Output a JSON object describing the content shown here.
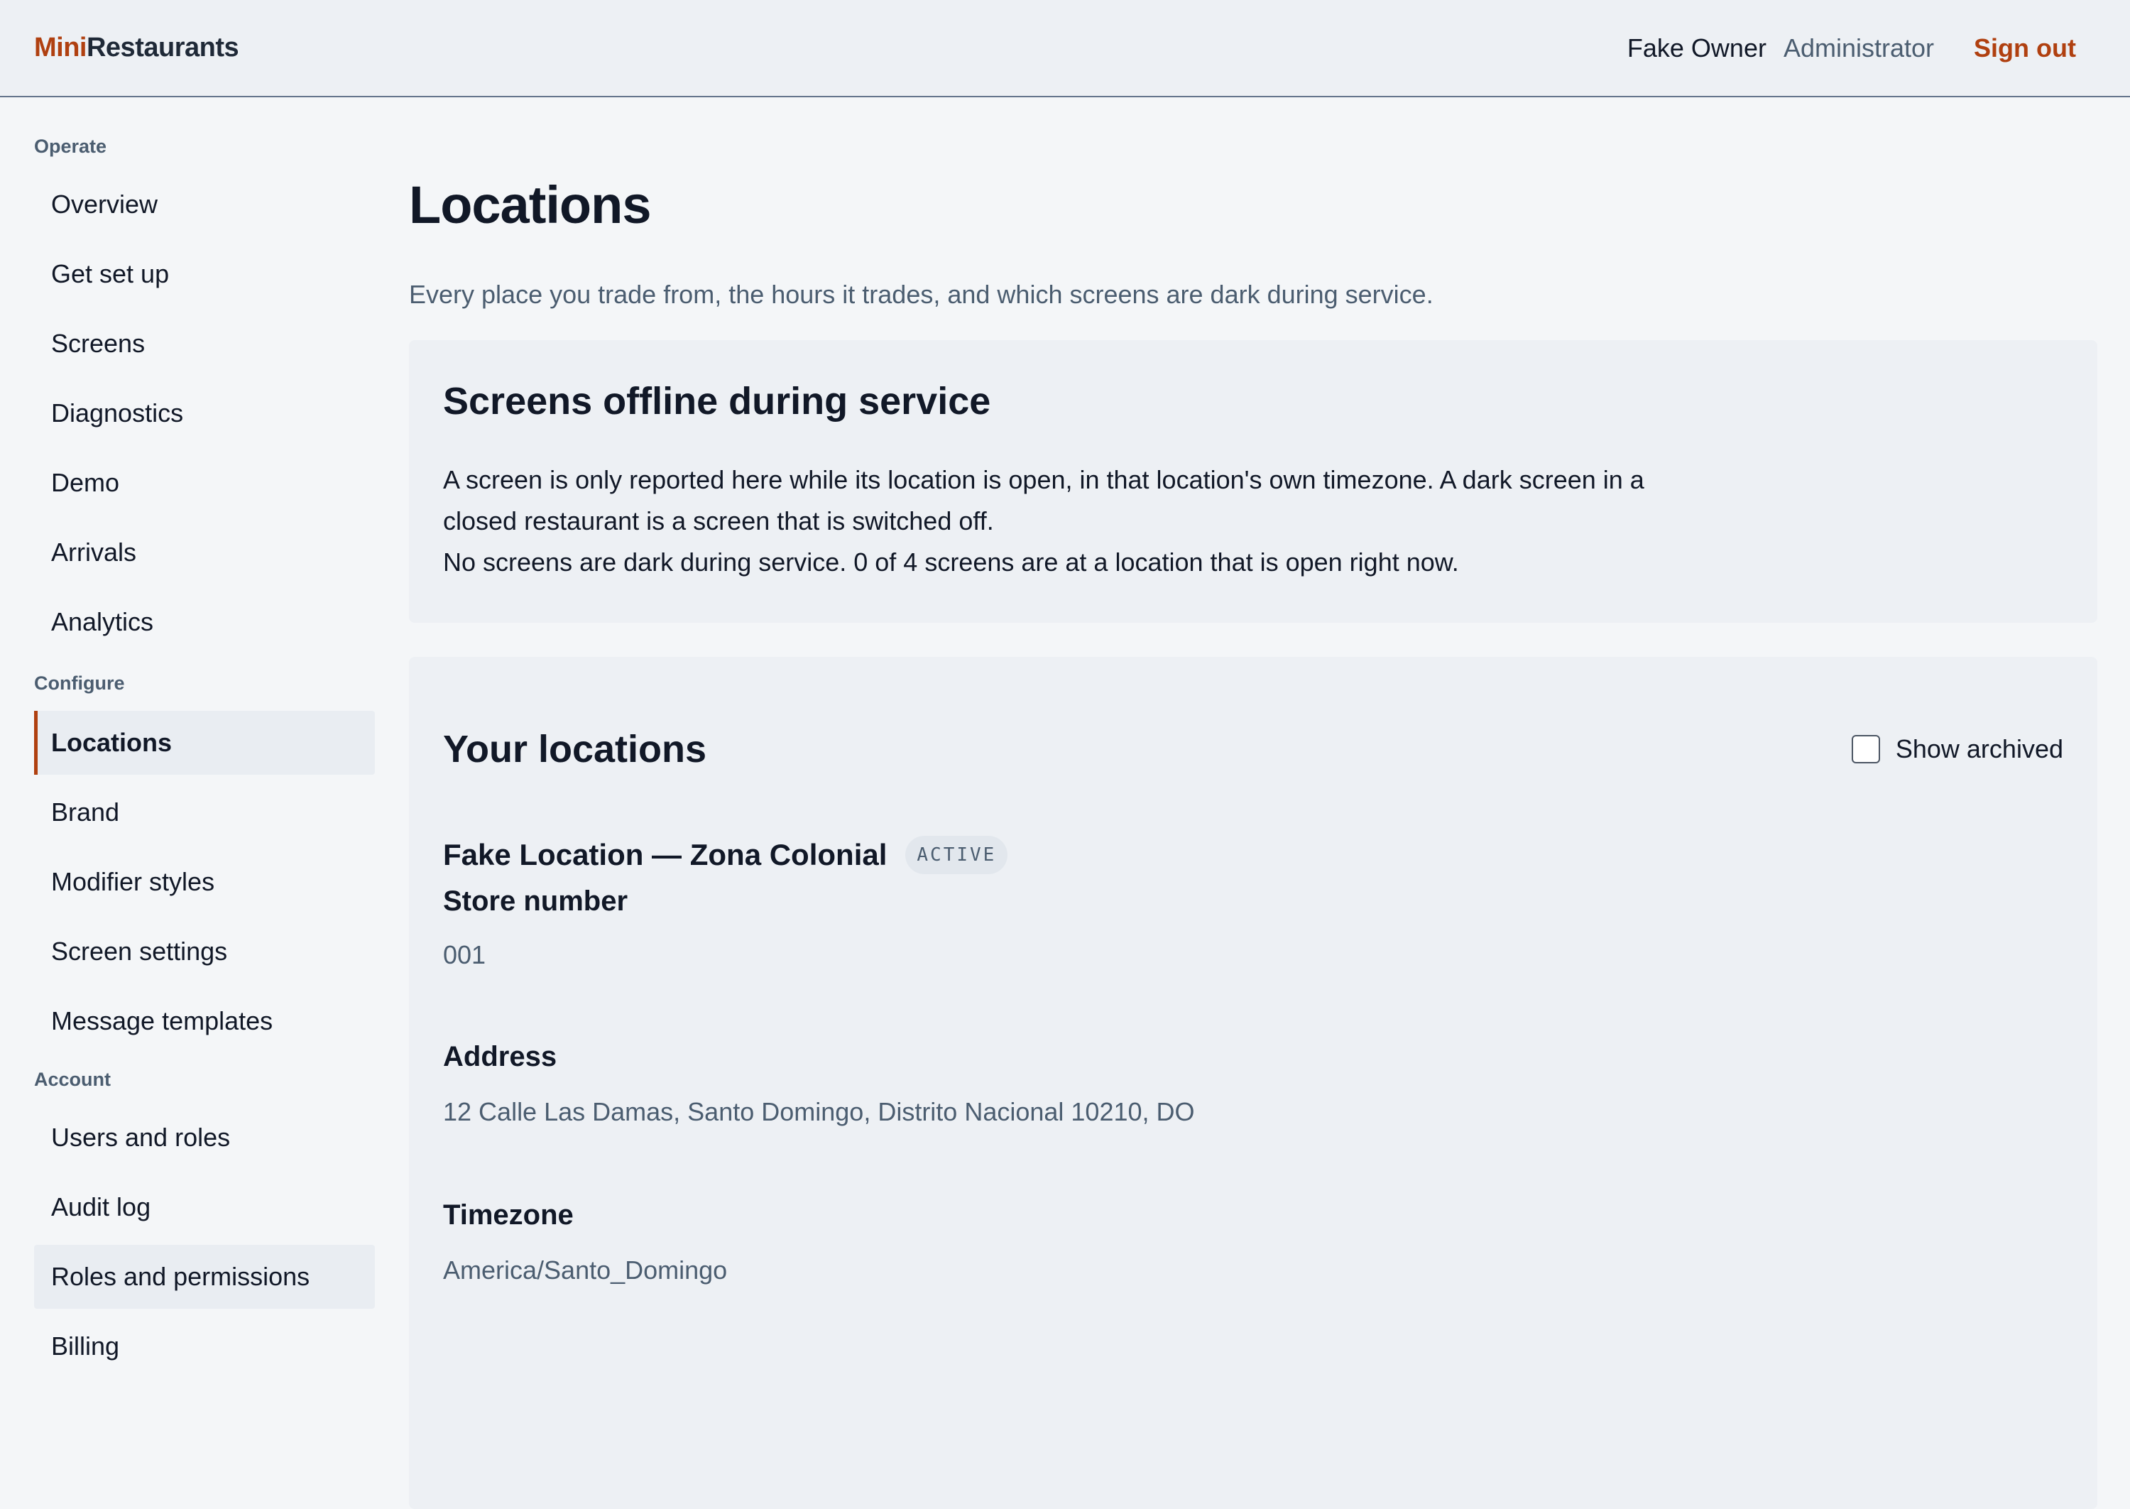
{
  "header": {
    "logo_part1": "Mini",
    "logo_part2": "Restaurants",
    "user_name": "Fake Owner",
    "user_role": "Administrator",
    "sign_out": "Sign out"
  },
  "sidebar": {
    "groups": [
      {
        "label": "Operate",
        "items": [
          "Overview",
          "Get set up",
          "Screens",
          "Diagnostics",
          "Demo",
          "Arrivals",
          "Analytics"
        ]
      },
      {
        "label": "Configure",
        "items": [
          "Locations",
          "Brand",
          "Modifier styles",
          "Screen settings",
          "Message templates"
        ]
      },
      {
        "label": "Account",
        "items": [
          "Users and roles",
          "Audit log",
          "Roles and permissions",
          "Billing"
        ]
      }
    ],
    "active_item": "Locations"
  },
  "main": {
    "title": "Locations",
    "subtitle": "Every place you trade from, the hours it trades, and which screens are dark during service.",
    "offline_card": {
      "title": "Screens offline during service",
      "description": "A screen is only reported here while its location is open, in that location's own timezone. A dark screen in a closed restaurant is a screen that is switched off.",
      "status": "No screens are dark during service. 0 of 4 screens are at a location that is open right now."
    },
    "locations_card": {
      "title": "Your locations",
      "show_archived_label": "Show archived",
      "show_archived_checked": false,
      "locations": [
        {
          "name": "Fake Location — Zona Colonial",
          "status": "ACTIVE",
          "store_number_label": "Store number",
          "store_number": "001",
          "address_label": "Address",
          "address": "12 Calle Las Damas, Santo Domingo, Distrito Nacional 10210, DO",
          "timezone_label": "Timezone",
          "timezone": "America/Santo_Domingo"
        }
      ]
    }
  },
  "colors": {
    "accent": "#b04010",
    "muted_text": "#4b5d70",
    "card_bg": "#edf0f4",
    "page_bg": "#f4f6f8"
  }
}
